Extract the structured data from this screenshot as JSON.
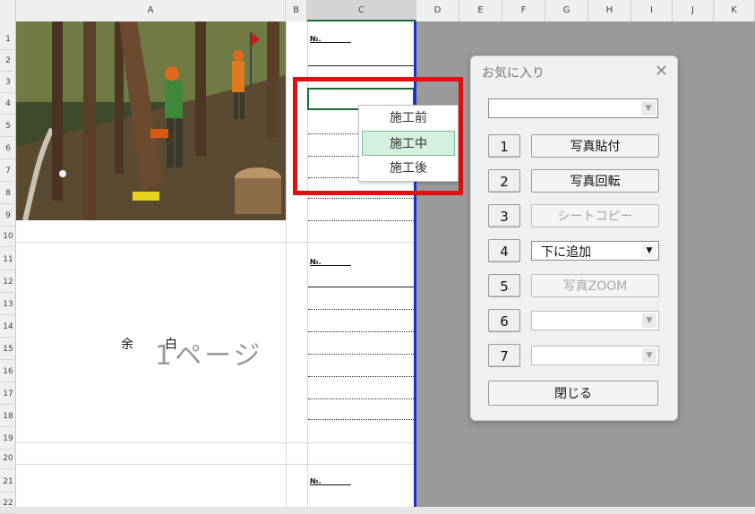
{
  "columns": [
    "A",
    "B",
    "C",
    "D",
    "E",
    "F",
    "G",
    "H",
    "I",
    "J",
    "K"
  ],
  "rows": [
    "1",
    "2",
    "3",
    "4",
    "5",
    "6",
    "7",
    "8",
    "9",
    "10",
    "11",
    "12",
    "13",
    "14",
    "15",
    "16",
    "17",
    "18",
    "19",
    "20",
    "21",
    "22"
  ],
  "sheet": {
    "no_label": "№.",
    "blank_text_1": "余",
    "blank_text_2": "白",
    "page_watermark": "1ページ"
  },
  "dropdown": {
    "items": [
      "施工前",
      "施工中",
      "施工後"
    ],
    "highlighted": "施工中"
  },
  "favorites_dialog": {
    "title": "お気に入り",
    "close_glyph": "✕",
    "combo_top_value": "",
    "numbers": [
      "1",
      "2",
      "3",
      "4",
      "5",
      "6",
      "7"
    ],
    "actions": [
      "写真貼付",
      "写真回転",
      "シートコピー",
      "",
      "写真ZOOM",
      "",
      ""
    ],
    "combo_4_value": "下に追加",
    "close_button": "閉じる"
  },
  "colors": {
    "highlight_border": "#e01010",
    "print_edge": "#1b2fd1",
    "selection": "#1e6b3a"
  }
}
